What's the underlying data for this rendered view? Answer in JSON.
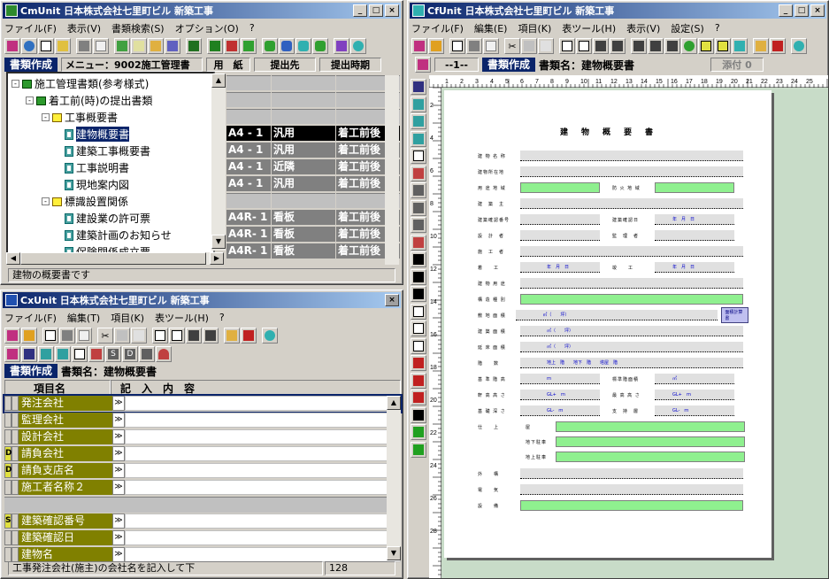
{
  "cm": {
    "title": "CmUnit 日本株式会社七里町ビル 新築工事",
    "menu": [
      "ファイル(F)",
      "表示(V)",
      "書類検索(S)",
      "オプション(O)",
      "?"
    ],
    "header_doc": "書類作成",
    "header_menu": "メニュー：9002施工管理書",
    "col_paper": "用　紙",
    "col_submit_to": "提出先",
    "col_submit_time": "提出時期",
    "tree": [
      {
        "label": "施工管理書類(参考様式)",
        "level": 0,
        "type": "folder-green",
        "toggle": "-"
      },
      {
        "label": "着工前(時)の提出書類",
        "level": 1,
        "type": "folder-green",
        "toggle": "-"
      },
      {
        "label": "工事概要書",
        "level": 2,
        "type": "folder",
        "toggle": "-"
      },
      {
        "label": "建物概要書",
        "level": 3,
        "type": "doc",
        "selected": true
      },
      {
        "label": "建築工事概要書",
        "level": 3,
        "type": "doc"
      },
      {
        "label": "工事説明書",
        "level": 3,
        "type": "doc"
      },
      {
        "label": "現地案内図",
        "level": 3,
        "type": "doc"
      },
      {
        "label": "標識設置関係",
        "level": 2,
        "type": "folder",
        "toggle": "-"
      },
      {
        "label": "建設業の許可票",
        "level": 3,
        "type": "doc"
      },
      {
        "label": "建築計画のお知らせ",
        "level": 3,
        "type": "doc"
      },
      {
        "label": "保険関係成立票",
        "level": 3,
        "type": "doc"
      }
    ],
    "grid_rows": [
      {
        "paper": "",
        "to": "",
        "time": ""
      },
      {
        "paper": "",
        "to": "",
        "time": ""
      },
      {
        "paper": "",
        "to": "",
        "time": ""
      },
      {
        "paper": "A4 - 1",
        "to": "汎用",
        "time": "着工前後",
        "selected": true
      },
      {
        "paper": "A4 - 1",
        "to": "汎用",
        "time": "着工前後"
      },
      {
        "paper": "A4 - 1",
        "to": "近隣",
        "time": "着工前後"
      },
      {
        "paper": "A4 - 1",
        "to": "汎用",
        "time": "着工前後"
      },
      {
        "paper": "",
        "to": "",
        "time": ""
      },
      {
        "paper": "A4R- 1",
        "to": "看板",
        "time": "着工前後"
      },
      {
        "paper": "A4R- 1",
        "to": "看板",
        "time": "着工前後"
      },
      {
        "paper": "A4R- 1",
        "to": "看板",
        "time": "着工前後"
      }
    ],
    "status": "建物の概要書です"
  },
  "cx": {
    "title": "CxUnit 日本株式会社七里町ビル 新築工事",
    "menu": [
      "ファイル(F)",
      "編集(T)",
      "項目(K)",
      "表ツール(H)",
      "?"
    ],
    "header_doc": "書類作成",
    "doc_name": "書類名：建物概要書",
    "col_item": "項目名",
    "col_content": "記　入　内　容",
    "rows": [
      {
        "mark": "",
        "label": "発注会社",
        "active": true
      },
      {
        "mark": "",
        "label": "監理会社"
      },
      {
        "mark": "",
        "label": "設計会社"
      },
      {
        "mark": "D",
        "label": "請負会社"
      },
      {
        "mark": "D",
        "label": "請負支店名"
      },
      {
        "mark": "",
        "label": "施工者名称２"
      },
      {
        "mark": "",
        "label": "",
        "blank": true
      },
      {
        "mark": "S",
        "label": "建築確認番号"
      },
      {
        "mark": "",
        "label": "建築確認日"
      },
      {
        "mark": "",
        "label": "建物名"
      }
    ],
    "status": "工事発注会社(施主)の会社名を記入して下",
    "status_count": "128"
  },
  "cf": {
    "title": "CfUnit 日本株式会社七里町ビル 新築工事",
    "menu": [
      "ファイル(F)",
      "編集(E)",
      "項目(K)",
      "表ツール(H)",
      "表示(V)",
      "設定(S)",
      "?"
    ],
    "page_indicator": "--1--",
    "header_doc": "書類作成",
    "doc_name": "書類名：建物概要書",
    "attach": "添付 0",
    "ruler_h": [
      "1",
      "2",
      "3",
      "4",
      "5",
      "6",
      "7",
      "8",
      "9",
      "10",
      "11",
      "12",
      "13",
      "14",
      "15",
      "16",
      "17",
      "18",
      "19",
      "20",
      "21",
      "22",
      "23",
      "24",
      "25"
    ],
    "ruler_v": [
      "2",
      "4",
      "6",
      "8",
      "10",
      "12",
      "14",
      "16",
      "18",
      "20",
      "22",
      "24",
      "26",
      "28"
    ],
    "form": {
      "title": "建　物　概　要　書",
      "rows": [
        {
          "label": "建 物 名 称"
        },
        {
          "label": "建物所在地"
        },
        {
          "label": "用 途 地 域",
          "green": true,
          "sub": "防 火 地 域",
          "green2": true
        },
        {
          "label": "建　築　主"
        },
        {
          "label": "建築確認番号",
          "sub": "建築確認日",
          "subval": "年　月　日"
        },
        {
          "label": "設　計　者",
          "sub": "監　理　者"
        },
        {
          "label": "施　工　者"
        },
        {
          "label": "着　　工",
          "val": "年　月　日",
          "sub": "竣　　工",
          "subval": "年　月　日"
        },
        {
          "label": "建 物 用 途"
        },
        {
          "label": "構 造 種 別",
          "green": true
        },
        {
          "label": "敷 地 面 積",
          "val": "㎡（　　坪）",
          "button": "面積計算書"
        },
        {
          "label": "建 築 面 積",
          "val": "㎡（　　坪）"
        },
        {
          "label": "延 床 面 積",
          "val": "㎡（　　坪）"
        },
        {
          "label": "階　　数",
          "val": "地上　階　　地下　階　　塔屋　階"
        },
        {
          "label": "基 準 階 高",
          "val": "ｍ",
          "sub": "標準階面積",
          "subval": "㎡"
        },
        {
          "label": "軒 高 高 さ",
          "val": "GL+　ｍ",
          "sub": "最 高 高 さ",
          "subval": "GL+　ｍ"
        },
        {
          "label": "基 礎 深 さ",
          "val": "GL-　ｍ",
          "sub": "支　持　層",
          "subval": "GL-　ｍ"
        },
        {
          "label": "仕　　上",
          "multi": [
            "屋",
            "地下駐車",
            "地上駐車"
          ]
        },
        {
          "label": "外　　構"
        },
        {
          "label": "電　　気"
        },
        {
          "label": "設　　備",
          "green": true
        }
      ]
    }
  }
}
